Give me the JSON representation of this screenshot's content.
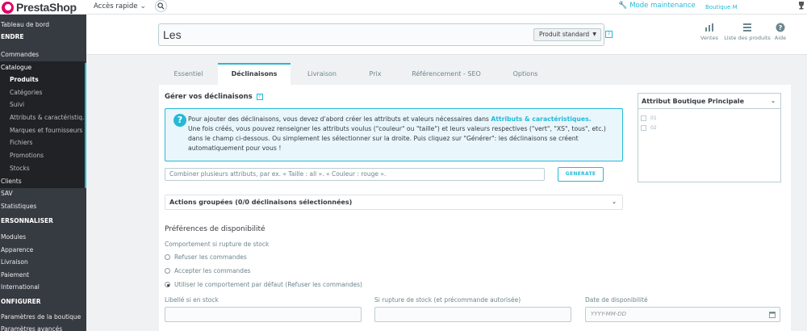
{
  "topbar": {
    "logo_text": "PrestaShop",
    "quick_access": "Accès rapide",
    "maintenance": "Mode maintenance",
    "shop_name": "Boutique M"
  },
  "sidebar": {
    "items": [
      {
        "label": "Tableau de bord"
      },
      {
        "label": "ENDRE"
      },
      {
        "label": "Commandes"
      },
      {
        "label": "Catalogue"
      },
      {
        "label": "Produits"
      },
      {
        "label": "Catégories"
      },
      {
        "label": "Suivi"
      },
      {
        "label": "Attributs & caractéristiq..."
      },
      {
        "label": "Marques et fournisseurs"
      },
      {
        "label": "Fichiers"
      },
      {
        "label": "Promotions"
      },
      {
        "label": "Stocks"
      },
      {
        "label": "Clients"
      },
      {
        "label": "SAV"
      },
      {
        "label": "Statistiques"
      },
      {
        "label": "ERSONNALISER"
      },
      {
        "label": "Modules"
      },
      {
        "label": "Apparence"
      },
      {
        "label": "Livraison"
      },
      {
        "label": "Paiement"
      },
      {
        "label": "International"
      },
      {
        "label": "ONFIGURER"
      },
      {
        "label": "Paramètres de la boutique"
      },
      {
        "label": "Paramètres avancés"
      }
    ]
  },
  "header": {
    "product_name": "Les",
    "product_type": "Produit standard",
    "help_mark": "?",
    "actions": [
      {
        "label": "Ventes",
        "icon": "bar-chart-icon"
      },
      {
        "label": "Liste des produits",
        "icon": "list-icon"
      },
      {
        "label": "Aide",
        "icon": "help-circle-icon"
      }
    ]
  },
  "tabs": [
    {
      "label": "Essentiel"
    },
    {
      "label": "Déclinaisons"
    },
    {
      "label": "Livraison"
    },
    {
      "label": "Prix"
    },
    {
      "label": "Référencement - SEO"
    },
    {
      "label": "Options"
    }
  ],
  "combinations": {
    "title": "Gérer vos déclinaisons",
    "info_icon": "?",
    "info_part1": "Pour ajouter des déclinaisons, vous devez d'abord créer les attributs et valeurs nécessaires dans",
    "info_link": "Attributs & caractéristiques.",
    "info_part2": "Une fois créés, vous pouvez renseigner les attributs voulus (\"couleur\" ou \"taille\") et leurs valeurs respectives (\"vert\", \"XS\", tous\", etc.) dans le champ ci-dessous. Ou simplement les sélectionner sur la droite. Puis cliquez sur \"Générer\": les déclinaisons se créent automatiquement pour vous !",
    "combine_placeholder": "Combiner plusieurs attributs, par ex. « Taille : all ». « Couleur : rouge ».",
    "generate_label": "GENERATE",
    "bulk_actions": "Actions groupées (0/0 déclinaisons sélectionnées)"
  },
  "availability": {
    "title": "Préférences de disponibilité",
    "oos_label": "Comportement si rupture de stock",
    "options": [
      {
        "label": "Refuser les commandes",
        "selected": false
      },
      {
        "label": "Accepter les commandes",
        "selected": false
      },
      {
        "label": "Utiliser le comportement par défaut (Refuser les commandes)",
        "selected": true
      }
    ],
    "in_stock_label": "Libellé si en stock",
    "oos_backorder_label": "Si rupture de stock (et précommande autorisée)",
    "date_label": "Date de disponibilité",
    "date_placeholder": "YYYY-MM-DD"
  },
  "attribute_panel": {
    "title": "Attribut Boutique Principale",
    "options": [
      "01",
      "02"
    ]
  }
}
